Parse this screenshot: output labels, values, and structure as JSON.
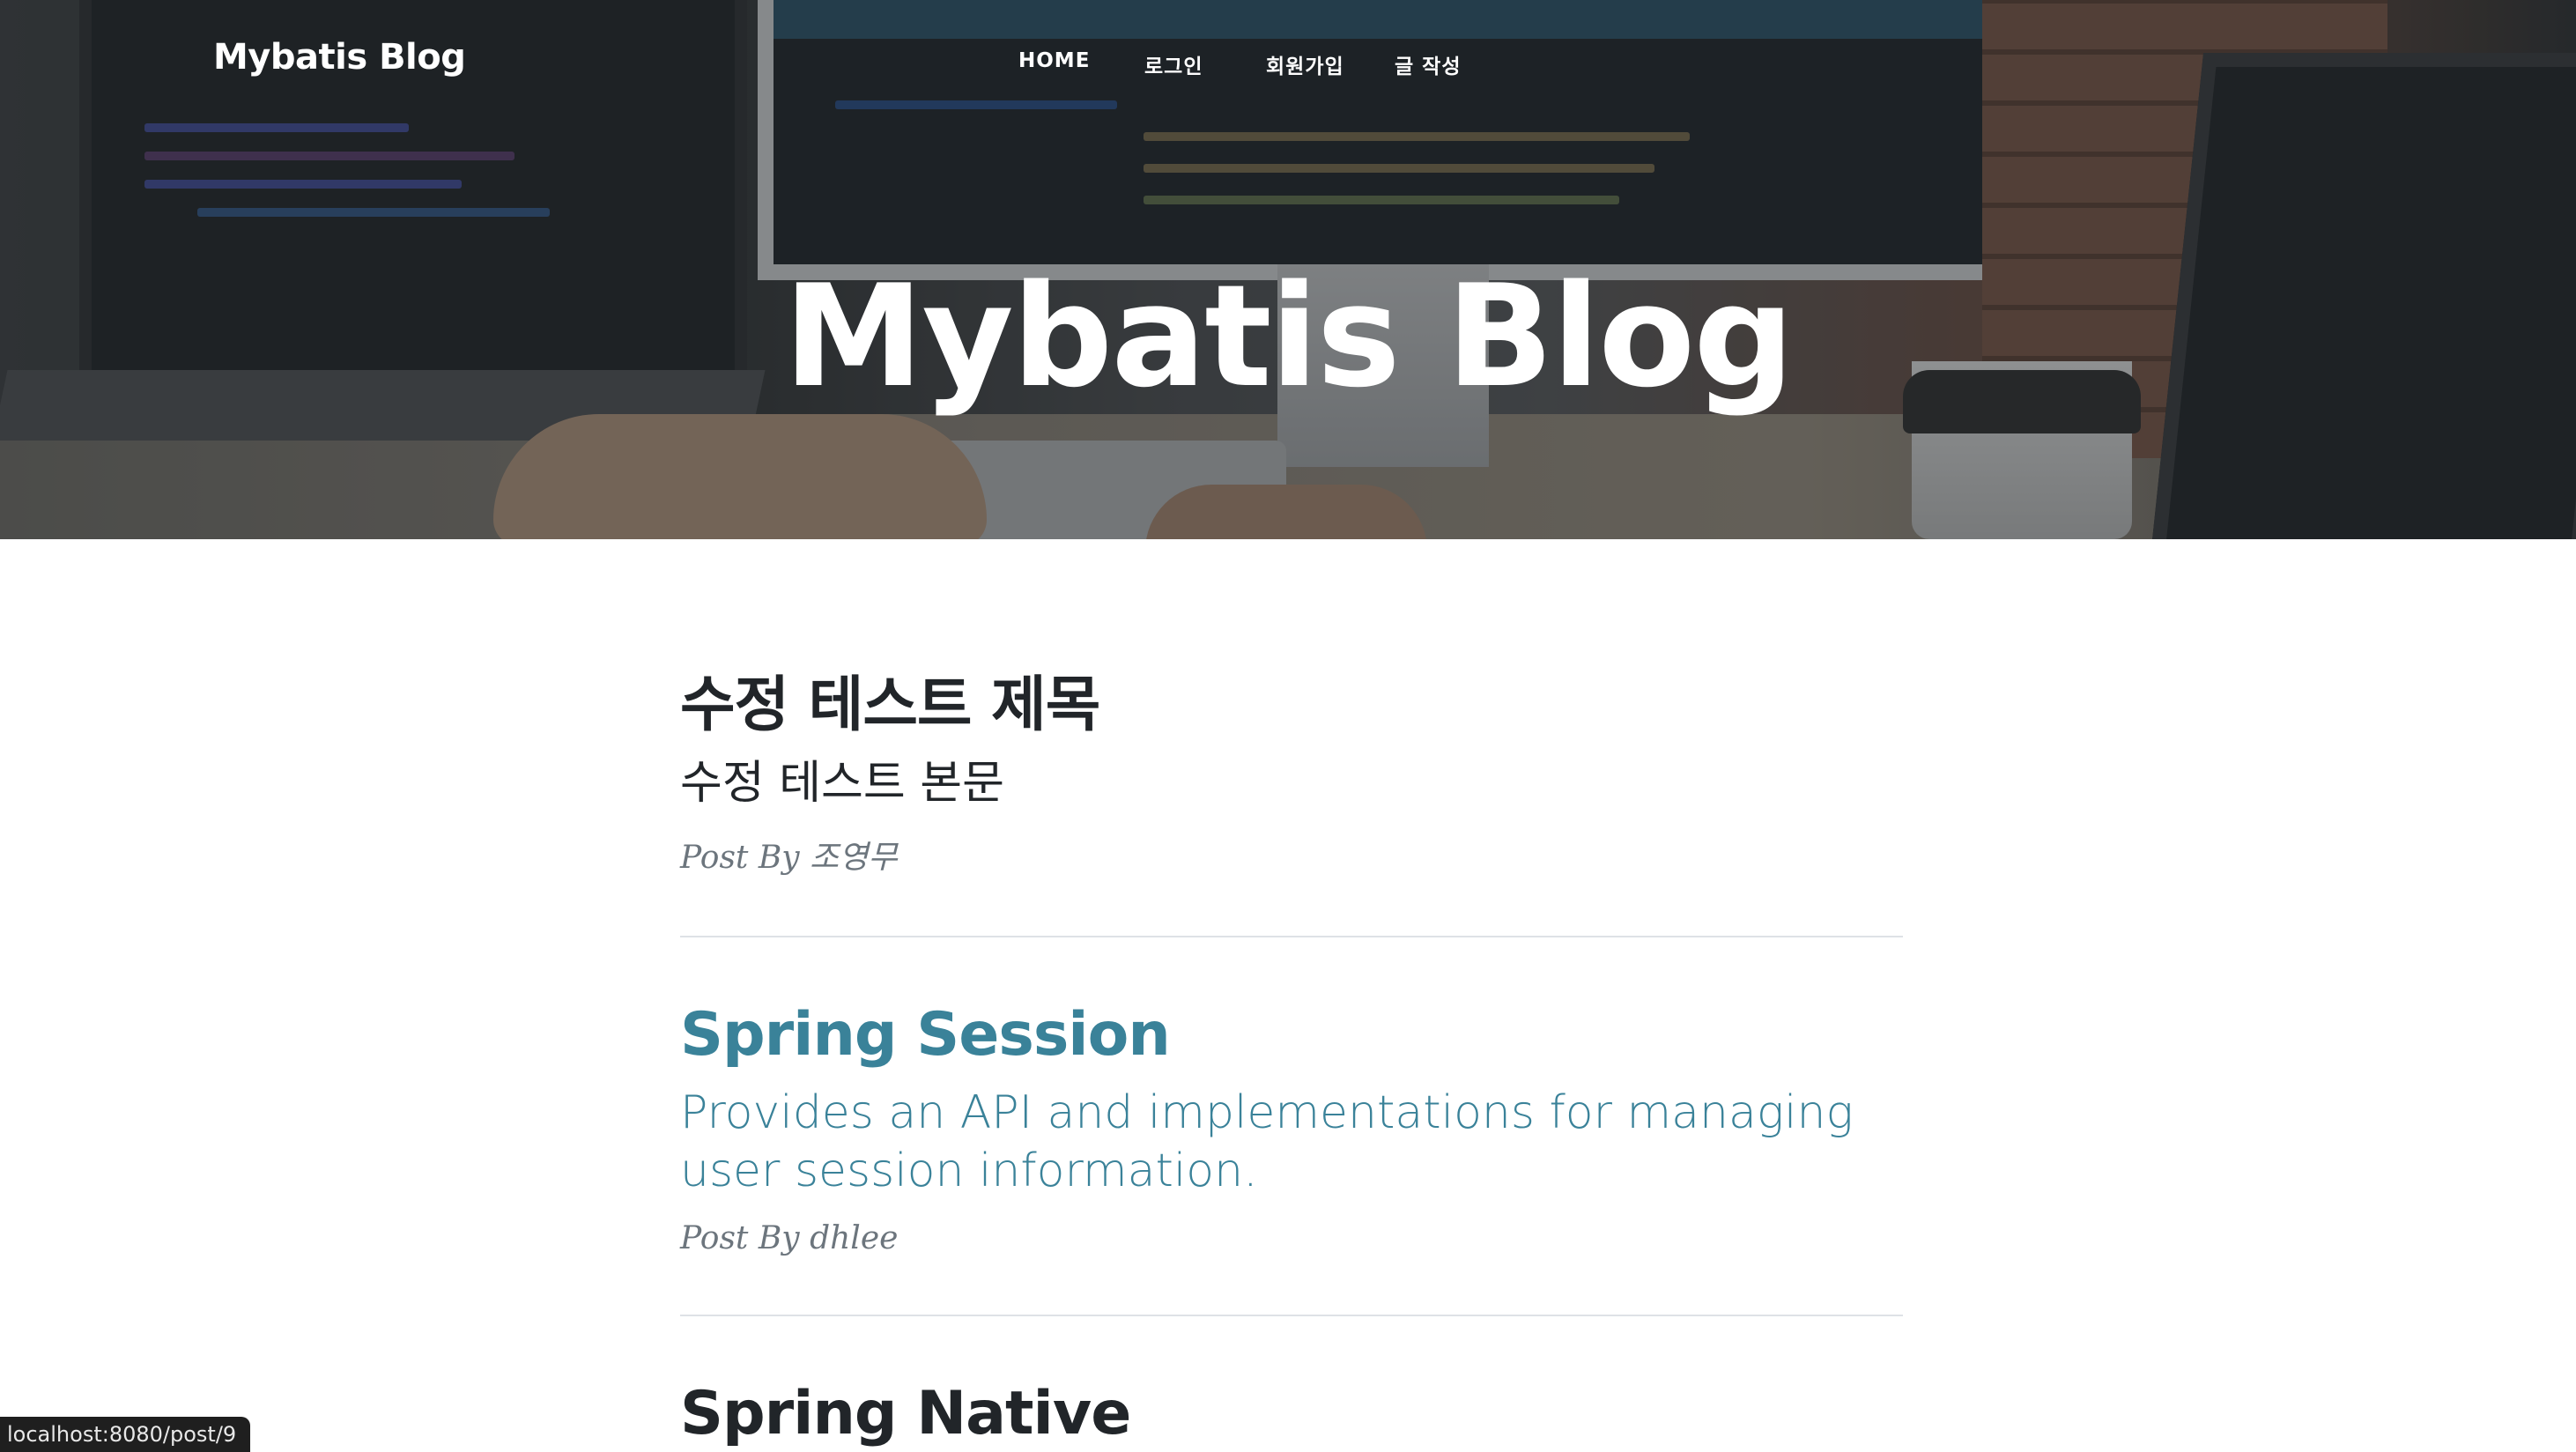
{
  "navbar": {
    "brand": "Mybatis Blog",
    "links": [
      {
        "label": "HOME"
      },
      {
        "label": "로그인"
      },
      {
        "label": "회원가입"
      },
      {
        "label": "글 작성"
      }
    ]
  },
  "hero": {
    "title": "Mybatis Blog"
  },
  "posts": [
    {
      "title": "수정 테스트 제목",
      "subtitle": "수정 테스트 본문",
      "meta_prefix": "Post By",
      "author": "조영무"
    },
    {
      "title": "Spring Session",
      "subtitle": "Provides an API and implementations for managing user session information.",
      "meta_prefix": "Post By",
      "author": "dhlee"
    },
    {
      "title": "Spring Native"
    }
  ],
  "status_bar": {
    "url": "localhost:8080/post/9"
  },
  "colors": {
    "link_hover": "#3a8299",
    "text": "#212529",
    "meta": "#6c757d"
  }
}
